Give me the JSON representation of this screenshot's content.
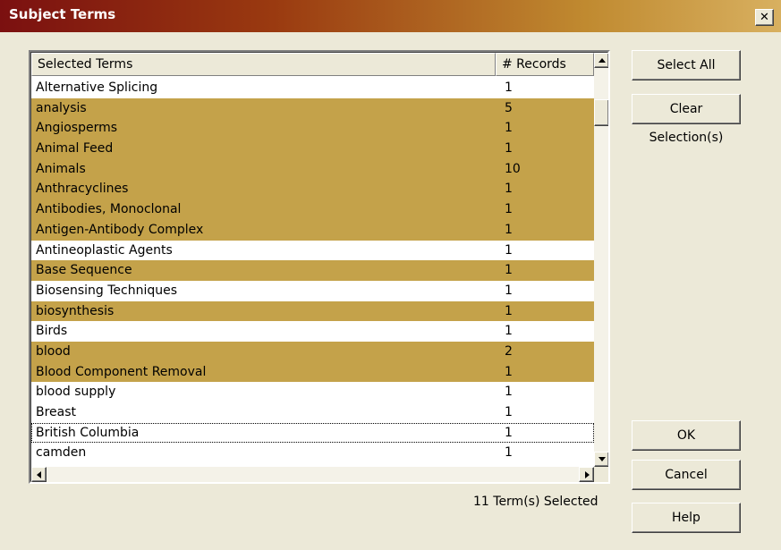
{
  "window": {
    "title": "Subject Terms",
    "close_glyph": "✕"
  },
  "list": {
    "columns": [
      "Selected Terms",
      "# Records"
    ],
    "rows": [
      {
        "term": "Alternative Splicing",
        "records": "1",
        "selected": false
      },
      {
        "term": "analysis",
        "records": "5",
        "selected": true
      },
      {
        "term": "Angiosperms",
        "records": "1",
        "selected": true
      },
      {
        "term": "Animal Feed",
        "records": "1",
        "selected": true
      },
      {
        "term": "Animals",
        "records": "10",
        "selected": true
      },
      {
        "term": "Anthracyclines",
        "records": "1",
        "selected": true
      },
      {
        "term": "Antibodies, Monoclonal",
        "records": "1",
        "selected": true
      },
      {
        "term": "Antigen-Antibody Complex",
        "records": "1",
        "selected": true
      },
      {
        "term": "Antineoplastic Agents",
        "records": "1",
        "selected": false
      },
      {
        "term": "Base Sequence",
        "records": "1",
        "selected": true
      },
      {
        "term": "Biosensing Techniques",
        "records": "1",
        "selected": false
      },
      {
        "term": "biosynthesis",
        "records": "1",
        "selected": true
      },
      {
        "term": "Birds",
        "records": "1",
        "selected": false
      },
      {
        "term": "blood",
        "records": "2",
        "selected": true
      },
      {
        "term": "Blood Component Removal",
        "records": "1",
        "selected": true
      },
      {
        "term": "blood supply",
        "records": "1",
        "selected": false
      },
      {
        "term": "Breast",
        "records": "1",
        "selected": false
      },
      {
        "term": "British Columbia",
        "records": "1",
        "selected": false,
        "focused": true
      },
      {
        "term": "camden",
        "records": "1",
        "selected": false
      }
    ]
  },
  "buttons": {
    "select_all": "Select All",
    "clear_selection": "Clear Selection(s)",
    "ok": "OK",
    "cancel": "Cancel",
    "help": "Help"
  },
  "status": "11 Term(s) Selected",
  "colors": {
    "selection": "#C4A24A",
    "dialog_bg": "#ECE9D8"
  }
}
